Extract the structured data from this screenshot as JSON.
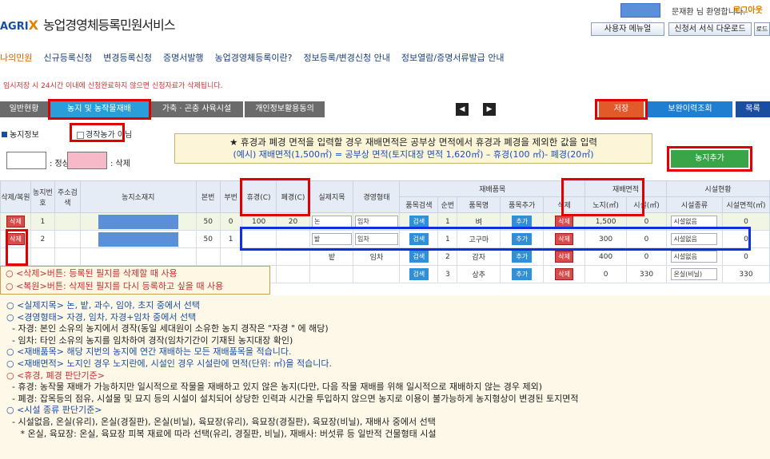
{
  "header": {
    "logo_prefix": "AGRI",
    "logo_x": "X",
    "title": "농업경영체등록민원서비스",
    "greeting": "문재환 님 환영합니다.",
    "logout": "로그아웃",
    "user_menu": "사용자 메뉴얼",
    "form_download": "신청서 서식 다운로드",
    "extra": "로드"
  },
  "nav": [
    "나의민원",
    "신규등록신청",
    "변경등록신청",
    "증명서발행",
    "농업경영체등록이란?",
    "정보등록/변경신청 안내",
    "정보열람/증명서류발급 안내"
  ],
  "notice": "임시저장 시 24시간 이내에 신청완료하지 않으면 신청자료가 삭제됩니다.",
  "tabs": {
    "general": "일반현황",
    "farmland": "농지 및 농작물재배",
    "livestock": "가축 · 곤충 사육시설",
    "consent": "개인정보활용동의",
    "save": "저장",
    "history": "보완이력조회",
    "list": "목록"
  },
  "section": {
    "farmland_info": "농지정보",
    "not_farmer": "경작농가 아님",
    "legend_normal": ": 정상",
    "legend_deleted": ": 삭제",
    "add_farmland": "농지추가"
  },
  "banner": {
    "line1": "★ 휴경과 폐경 면적을 입력할 경우 재배면적은 공부상 면적에서 휴경과 폐경을 제외한 값을 입력",
    "line2": "(예시) 재배면적(1,500㎡) = 공부상 면적(토지대장 면적 1,620㎡) – 휴경(100 ㎡)- 폐경(20㎡)"
  },
  "table": {
    "headers": {
      "del": "삭제/복원",
      "no": "농지번호",
      "addr": "주소검색",
      "location": "농지소재지",
      "main_no": "본번",
      "sub_no": "부번",
      "fallow": "휴경(C)",
      "abandon": "폐경(C)",
      "land_type": "실제지목",
      "manage": "경영형태",
      "crops": "재배품목",
      "crop_search": "품목검색",
      "seq": "순번",
      "crop_name": "품목명",
      "crop_add": "품목추가",
      "crop_del": "삭제",
      "area": "재배면적",
      "open_field": "노지(㎡)",
      "facility_area": "시설(㎡)",
      "facility": "시설현황",
      "facility_type": "시설종류",
      "facility_size": "시설면적(㎡)"
    },
    "rows": [
      {
        "del": "삭제",
        "no": "1",
        "main": "50",
        "sub": "0",
        "fallow": "100",
        "abandon": "20",
        "land": "논",
        "manage": "임차",
        "search": "검색",
        "seq": "1",
        "crop": "벼",
        "add": "추가",
        "cdel": "삭제",
        "open": "1,500",
        "fac": "0",
        "ftype": "시설없음",
        "fsize": "0"
      },
      {
        "del": "삭제",
        "no": "2",
        "main": "50",
        "sub": "1",
        "fallow": "",
        "abandon": "",
        "land": "밭",
        "manage": "임차",
        "search": "검색",
        "seq": "1",
        "crop": "고구마",
        "add": "추가",
        "cdel": "삭제",
        "open": "300",
        "fac": "0",
        "ftype": "시설없음",
        "fsize": "0"
      },
      {
        "del": "",
        "no": "",
        "main": "",
        "sub": "",
        "fallow": "",
        "abandon": "",
        "land": "밭",
        "manage": "임차",
        "search": "검색",
        "seq": "2",
        "crop": "감자",
        "add": "추가",
        "cdel": "삭제",
        "open": "400",
        "fac": "0",
        "ftype": "시설없음",
        "fsize": "0"
      },
      {
        "del": "",
        "no": "",
        "main": "",
        "sub": "",
        "fallow": "",
        "abandon": "",
        "land": "",
        "manage": "",
        "search": "검색",
        "seq": "3",
        "crop": "상추",
        "add": "추가",
        "cdel": "삭제",
        "open": "0",
        "fac": "330",
        "ftype": "온실(비닐)",
        "fsize": "330"
      }
    ]
  },
  "tip": {
    "line1": "○ <삭제>버튼: 등록된 필지를 삭제할 때 사용",
    "line2": "○ <복원>버튼: 삭제된 필지를 다시 등록하고 싶을 때 사용"
  },
  "help": [
    "○ <실제지목> 논, 밭, 과수, 임야, 초지 중에서 선택",
    "○ <경영형태> 자경, 임차, 자경+임차 중에서 선택",
    "  - 자경: 본인 소유의 농지에서 경작(동일 세대원이 소유한 농지 경작은 \"자경 \" 에 해당)",
    "  - 임차: 타인 소유의 농지를 임차하여 경작(임차기간이 기재된 농지대장 확인)",
    "○ <재배품목> 해당 지번의 농지에 연간 재배하는 모든 재배품목을 적습니다.",
    "○ <재배면적> 노지인 경우 노지란에, 시설인 경우 시설란에 면적(단위: ㎡)을 적습니다.",
    "○ <휴경, 폐경 판단기준>",
    "  - 휴경: 농작물 재배가 가능하지만 일시적으로 작물을 재배하고 있지 않은 농지(다만, 다음 작물 재배를 위해 일시적으로 재배하지 않는 경우 제외)",
    "  - 폐경: 잡목등의 점유, 시설물 및 묘지 등의 시설이 설치되어 상당한 인력과 시간을 투입하지 않으면 농지로 이용이 불가능하게 농지형상이 변경된 토지면적",
    "○ <시설 종류 판단기준>",
    "  - 시설없음, 온실(유리), 온실(경질판), 온실(비닐), 육묘장(유리), 육묘장(경질판), 육묘장(비닐), 재배사 중에서 선택",
    "     * 온실, 육묘장: 온실, 육묘장 피복 재료에 따라 선택(유리, 경질판, 비닐), 재배사: 버섯류 등 일반적 건물형태 시설"
  ]
}
